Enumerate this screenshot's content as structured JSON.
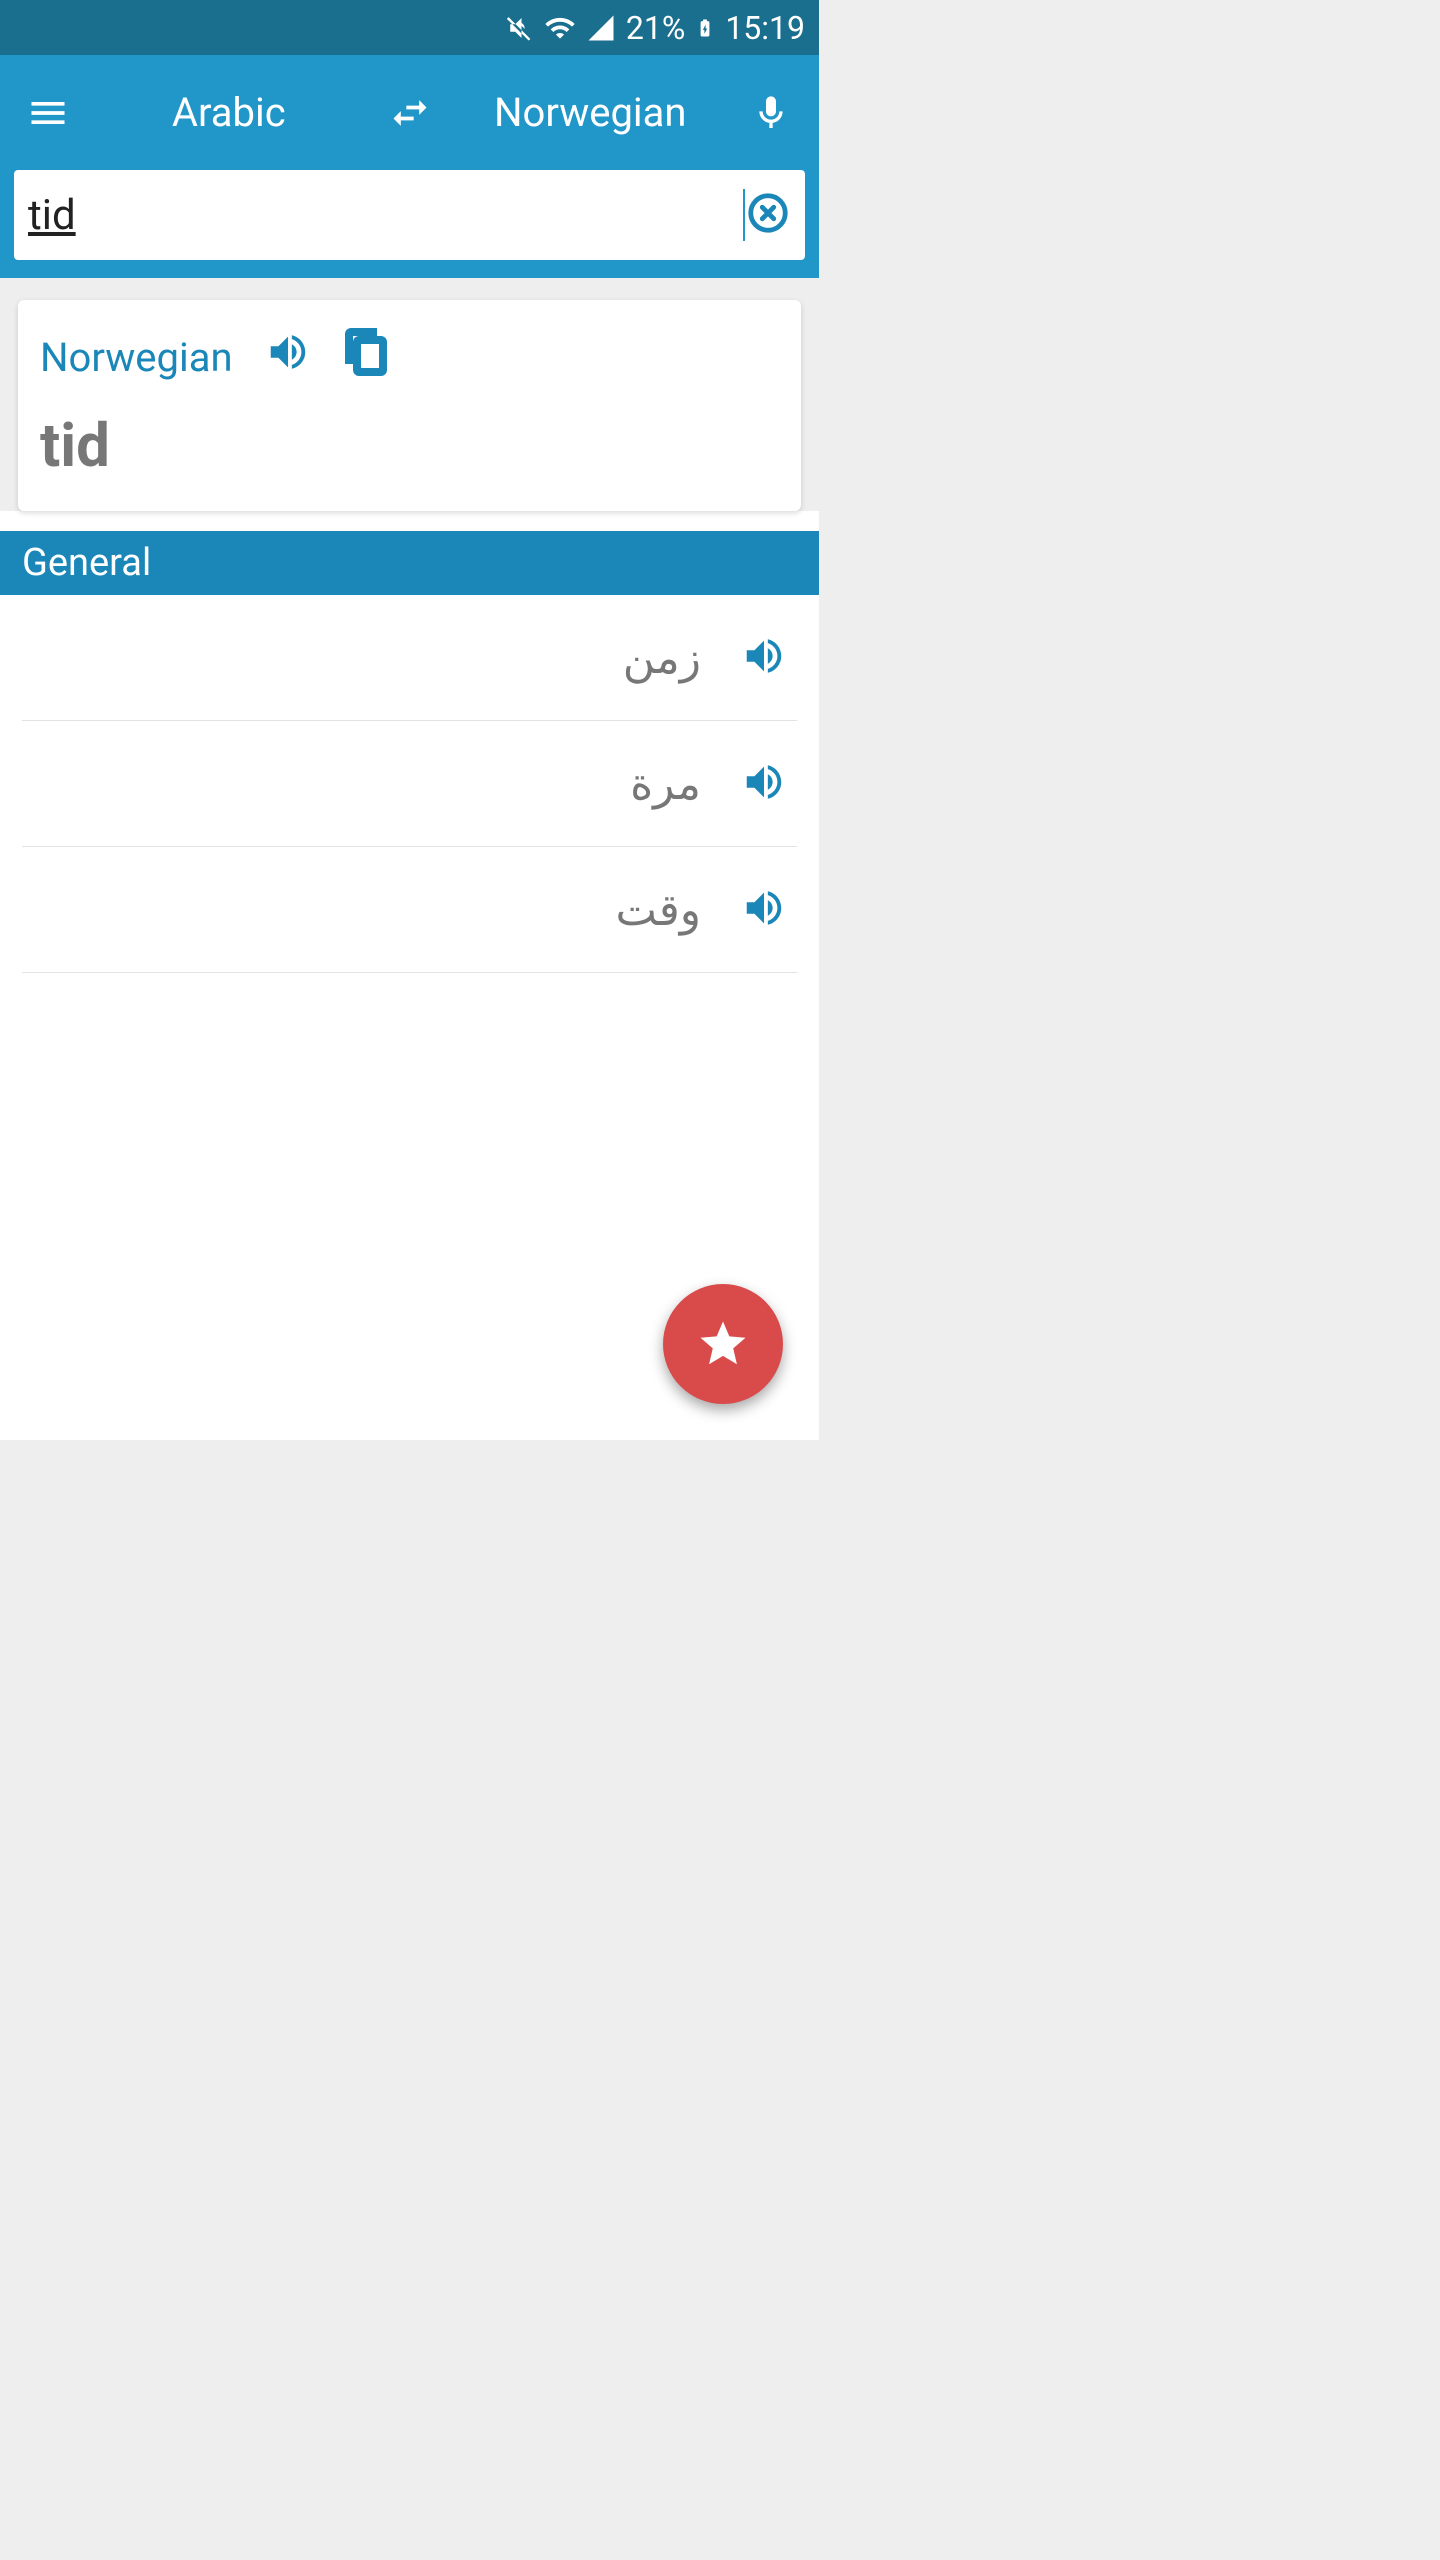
{
  "status": {
    "battery": "21%",
    "time": "15:19"
  },
  "header": {
    "lang_from": "Arabic",
    "lang_to": "Norwegian"
  },
  "search": {
    "value": "tid"
  },
  "card": {
    "label": "Norwegian",
    "word": "tid"
  },
  "section": {
    "title": "General"
  },
  "translations": [
    {
      "text": "زمن"
    },
    {
      "text": "مرة"
    },
    {
      "text": "وقت"
    }
  ]
}
